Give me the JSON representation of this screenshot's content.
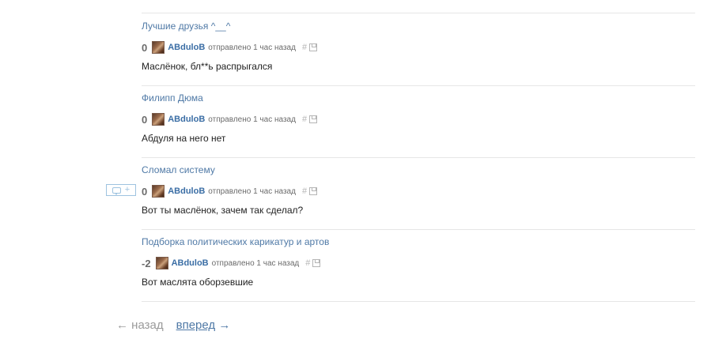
{
  "comments": [
    {
      "post_title": "Лучшие друзья ^__^",
      "rating": "0",
      "user": "ABduloB",
      "sent": "отправлено 1 час назад",
      "hash": "#",
      "text": "Маслёнок, бл**ь распрыгался"
    },
    {
      "post_title": "Филипп Дюма",
      "rating": "0",
      "user": "ABduloB",
      "sent": "отправлено 1 час назад",
      "hash": "#",
      "text": "Абдуля на него нет"
    },
    {
      "post_title": "Сломал систему",
      "rating": "0",
      "user": "ABduloB",
      "sent": "отправлено 1 час назад",
      "hash": "#",
      "text": "Вот ты маслёнок, зачем так сделал?"
    },
    {
      "post_title": "Подборка политических карикатур и артов",
      "rating": "-2",
      "user": "ABduloB",
      "sent": "отправлено 1 час назад",
      "hash": "#",
      "text": "Вот маслята оборзевшие"
    }
  ],
  "reply_button": {
    "plus": "+"
  },
  "pager": {
    "prev_arrow": "←",
    "prev_label": "назад",
    "next_label": "вперед",
    "next_arrow": "→"
  }
}
